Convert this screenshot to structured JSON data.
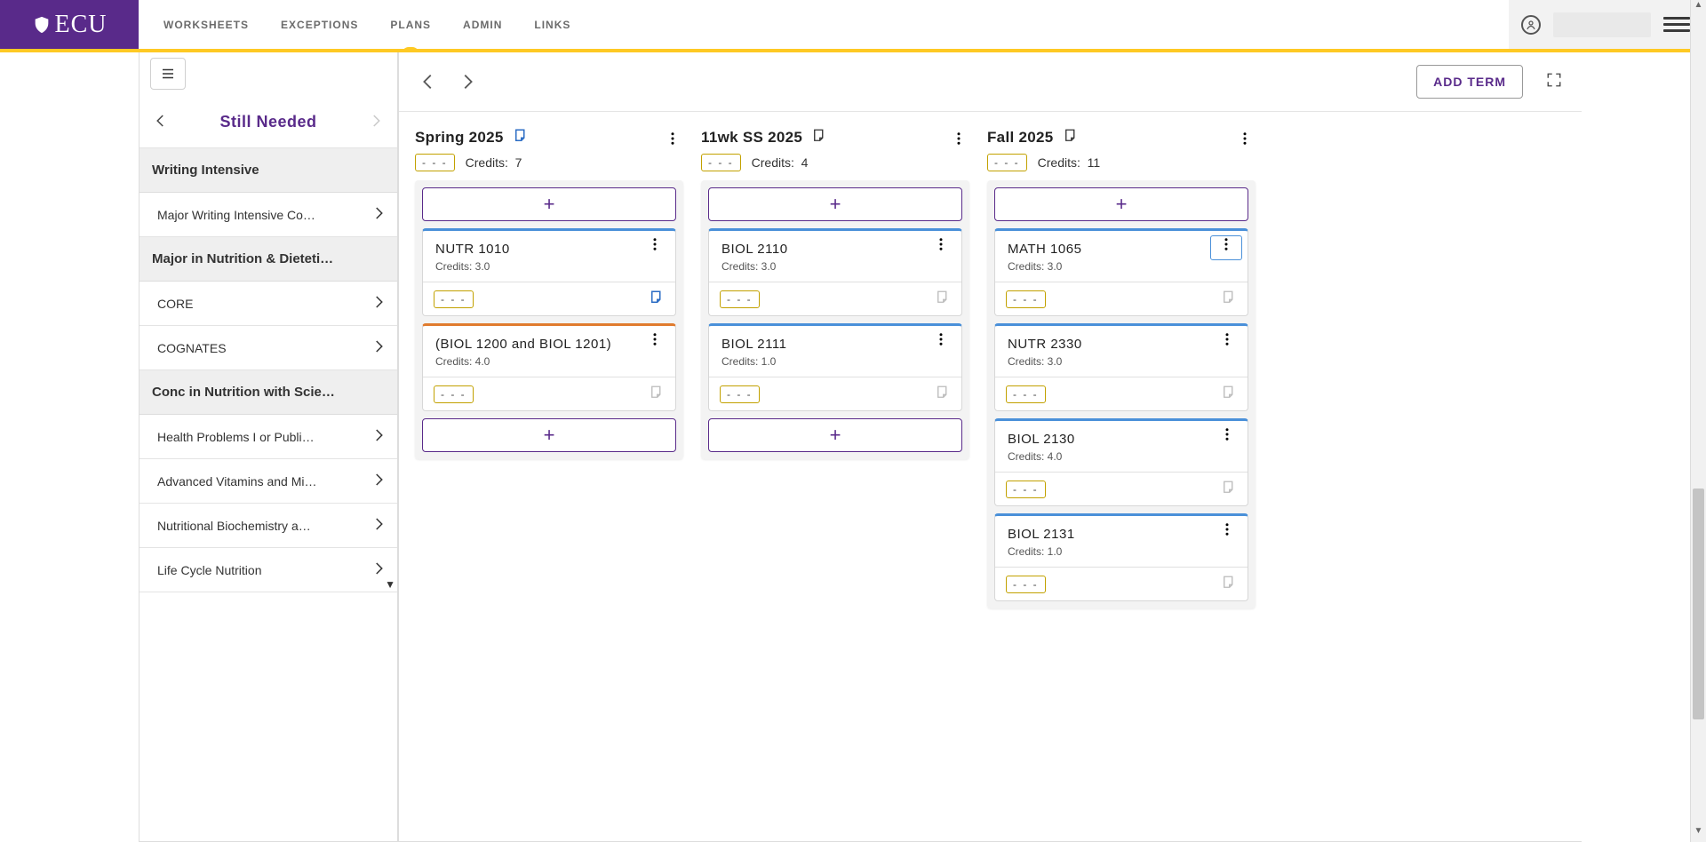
{
  "brand": "ECU",
  "nav": {
    "tabs": [
      {
        "id": "worksheets",
        "label": "WORKSHEETS"
      },
      {
        "id": "exceptions",
        "label": "EXCEPTIONS"
      },
      {
        "id": "plans",
        "label": "PLANS"
      },
      {
        "id": "admin",
        "label": "ADMIN"
      },
      {
        "id": "links",
        "label": "LINKS"
      }
    ],
    "active": "plans"
  },
  "left_panel": {
    "title": "Still Needed",
    "groups": [
      {
        "title": "Writing Intensive",
        "items": [
          {
            "id": "major-wi",
            "label": "Major Writing Intensive Co…"
          }
        ]
      },
      {
        "title": "Major in Nutrition & Dieteti…",
        "items": [
          {
            "id": "core",
            "label": "CORE"
          },
          {
            "id": "cognates",
            "label": "COGNATES"
          }
        ]
      },
      {
        "title": "Conc in Nutrition with Scie…",
        "items": [
          {
            "id": "health-problems",
            "label": "Health Problems I or Publi…"
          },
          {
            "id": "adv-vitamins",
            "label": "Advanced Vitamins and Mi…"
          },
          {
            "id": "nutr-biochem",
            "label": "Nutritional Biochemistry a…"
          },
          {
            "id": "life-cycle",
            "label": "Life Cycle Nutrition"
          }
        ]
      }
    ]
  },
  "plan": {
    "add_term_label": "ADD TERM",
    "glyphs": {
      "dash_chip": "- - -",
      "credits_label": "Credits:"
    },
    "terms": [
      {
        "id": "spring25",
        "title": "Spring 2025",
        "has_note": true,
        "note_filled": true,
        "credits": "7",
        "courses": [
          {
            "code": "NUTR 1010",
            "credits": "3.0",
            "kind": "blue",
            "note": true
          },
          {
            "code": "(BIOL 1200 and BIOL 1201)",
            "credits": "4.0",
            "kind": "orange",
            "note": false
          }
        ],
        "show_bottom_add": true
      },
      {
        "id": "ss25",
        "title": "11wk SS 2025",
        "has_note": true,
        "note_filled": false,
        "credits": "4",
        "courses": [
          {
            "code": "BIOL 2110",
            "credits": "3.0",
            "kind": "blue",
            "note": false
          },
          {
            "code": "BIOL 2111",
            "credits": "1.0",
            "kind": "blue",
            "note": false
          }
        ],
        "show_bottom_add": true
      },
      {
        "id": "fall25",
        "title": "Fall 2025",
        "has_note": true,
        "note_filled": false,
        "credits": "11",
        "courses": [
          {
            "code": "MATH 1065",
            "credits": "3.0",
            "kind": "blue",
            "note": false,
            "menu_focused": true
          },
          {
            "code": "NUTR 2330",
            "credits": "3.0",
            "kind": "blue",
            "note": false
          },
          {
            "code": "BIOL 2130",
            "credits": "4.0",
            "kind": "blue",
            "note": false
          },
          {
            "code": "BIOL 2131",
            "credits": "1.0",
            "kind": "blue",
            "note": false
          }
        ],
        "show_bottom_add": false
      }
    ]
  }
}
